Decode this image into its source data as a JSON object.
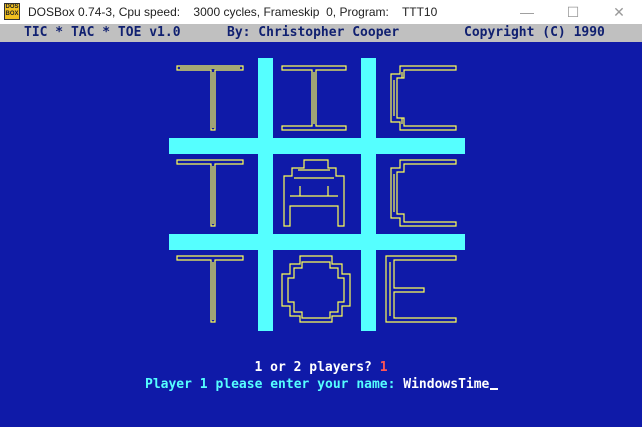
{
  "window": {
    "title": "DOSBox 0.74-3, Cpu speed:    3000 cycles, Frameskip  0, Program:    TTT10",
    "icon_label": "DOS BOX",
    "controls": {
      "minimize": "—",
      "maximize": "☐",
      "close": "✕"
    }
  },
  "game": {
    "title": "TIC * TAC * TOE v1.0",
    "author": "By: Christopher Cooper",
    "copyright": "Copyright (C) 1990",
    "players_prompt": "1 or 2 players? ",
    "players_answer": "1",
    "name_prompt": "Player 1 please enter your name: ",
    "name_value": "WindowsTime"
  },
  "colors": {
    "background": "#0f1aa8",
    "grid": "#55ffff",
    "letters": "#ffff55",
    "header_bar": "#c0c0c0"
  }
}
